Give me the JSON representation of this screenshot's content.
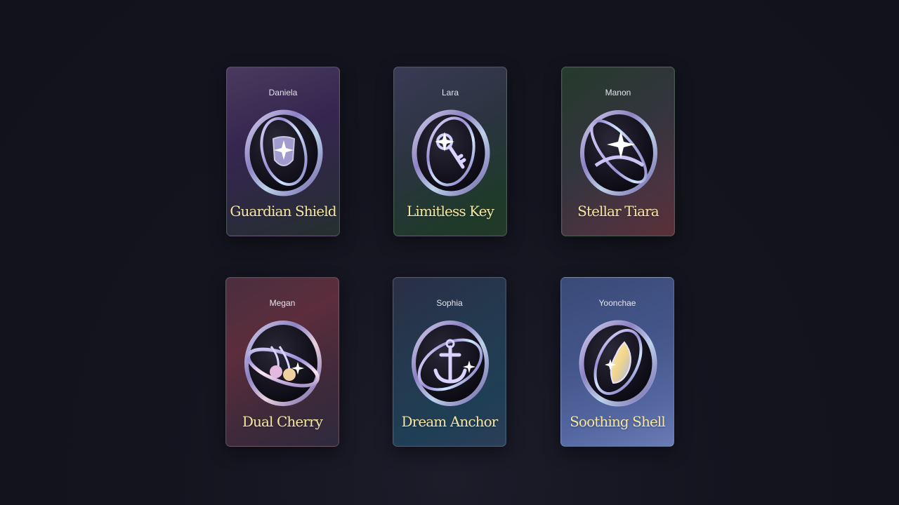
{
  "cards": [
    {
      "name": "Daniela",
      "title": "Guardian Shield",
      "icon": "shield-icon"
    },
    {
      "name": "Lara",
      "title": "Limitless Key",
      "icon": "key-icon"
    },
    {
      "name": "Manon",
      "title": "Stellar Tiara",
      "icon": "tiara-icon"
    },
    {
      "name": "Megan",
      "title": "Dual Cherry",
      "icon": "cherry-icon"
    },
    {
      "name": "Sophia",
      "title": "Dream Anchor",
      "icon": "anchor-icon"
    },
    {
      "name": "Yoonchae",
      "title": "Soothing Shell",
      "icon": "shell-icon"
    }
  ],
  "colors": {
    "background": "#14141f",
    "title_text": "#f5e6a6",
    "name_text": "#e4e4ee"
  }
}
